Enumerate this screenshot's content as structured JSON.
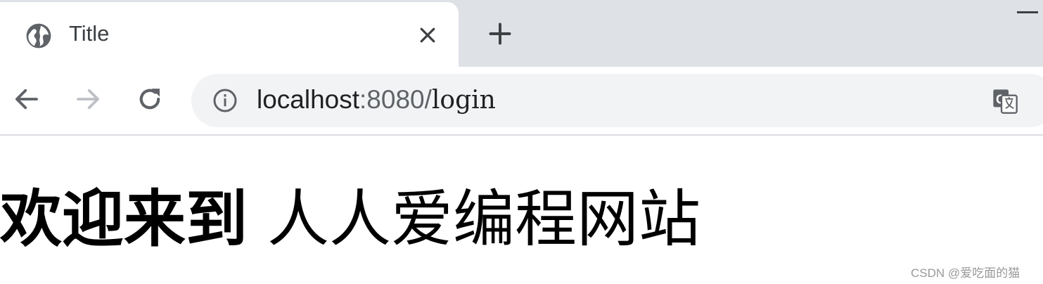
{
  "tab": {
    "title": "Title",
    "icon": "globe-icon"
  },
  "toolbar": {
    "back_icon": "arrow-left-icon",
    "forward_icon": "arrow-right-icon",
    "reload_icon": "reload-icon",
    "url_host": "localhost",
    "url_port": ":8080/",
    "url_path": "login",
    "translate_icon": "translate-icon"
  },
  "page": {
    "heading_bold": "欢迎来到",
    "heading_normal": " 人人爱编程网站"
  },
  "watermark": "CSDN @爱吃面的猫",
  "colors": {
    "tabstrip": "#dee1e6",
    "omnibox": "#f1f3f4",
    "icon": "#5f6368",
    "forward_disabled": "#bdc1c6"
  }
}
